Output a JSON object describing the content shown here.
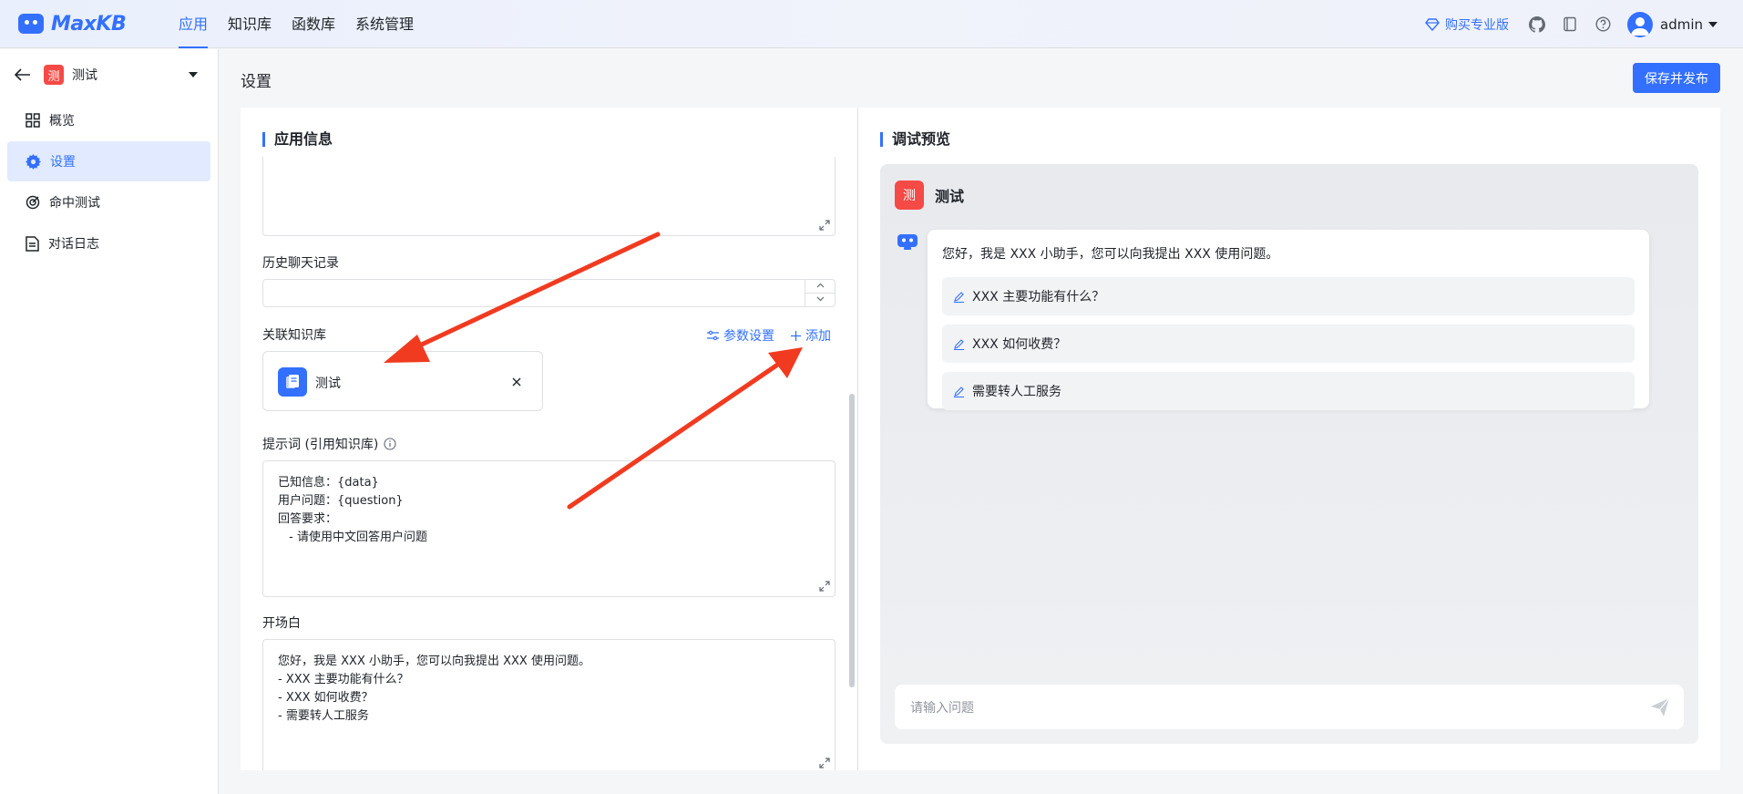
{
  "brand": {
    "name": "MaxKB"
  },
  "nav": [
    "应用",
    "知识库",
    "函数库",
    "系统管理"
  ],
  "topbar": {
    "buy_label": "购买专业版",
    "user": "admin"
  },
  "sidebar": {
    "app_badge": "测",
    "app_name": "测试",
    "items": [
      {
        "label": "概览",
        "icon": "grid-icon"
      },
      {
        "label": "设置",
        "icon": "gear-icon"
      },
      {
        "label": "命中测试",
        "icon": "target-icon"
      },
      {
        "label": "对话日志",
        "icon": "document-icon"
      }
    ]
  },
  "page": {
    "title": "设置",
    "save_label": "保存并发布"
  },
  "app_info": {
    "section_title": "应用信息",
    "history_label": "历史聊天记录",
    "history_value": "",
    "kb_label": "关联知识库",
    "param_settings": "参数设置",
    "add": "添加",
    "kb_items": [
      "测试"
    ],
    "prompt_label": "提示词 (引用知识库)",
    "prompt_lines": [
      "已知信息：{data}",
      "用户问题：{question}",
      "回答要求：",
      " - 请使用中文回答用户问题"
    ],
    "opening_label": "开场白",
    "opening_lines": [
      "您好，我是 XXX 小助手，您可以向我提出 XXX 使用问题。",
      "- XXX 主要功能有什么？",
      "- XXX 如何收费？",
      "- 需要转人工服务"
    ]
  },
  "preview": {
    "section_title": "调试预览",
    "app_badge": "测",
    "app_name": "测试",
    "greeting": "您好，我是 XXX 小助手，您可以向我提出 XXX 使用问题。",
    "questions": [
      "XXX 主要功能有什么？",
      "XXX 如何收费？",
      "需要转人工服务"
    ],
    "input_placeholder": "请输入问题"
  },
  "colors": {
    "primary": "#3370ff",
    "annotation_arrow": "#f03b20",
    "badge": "#f54a45"
  }
}
